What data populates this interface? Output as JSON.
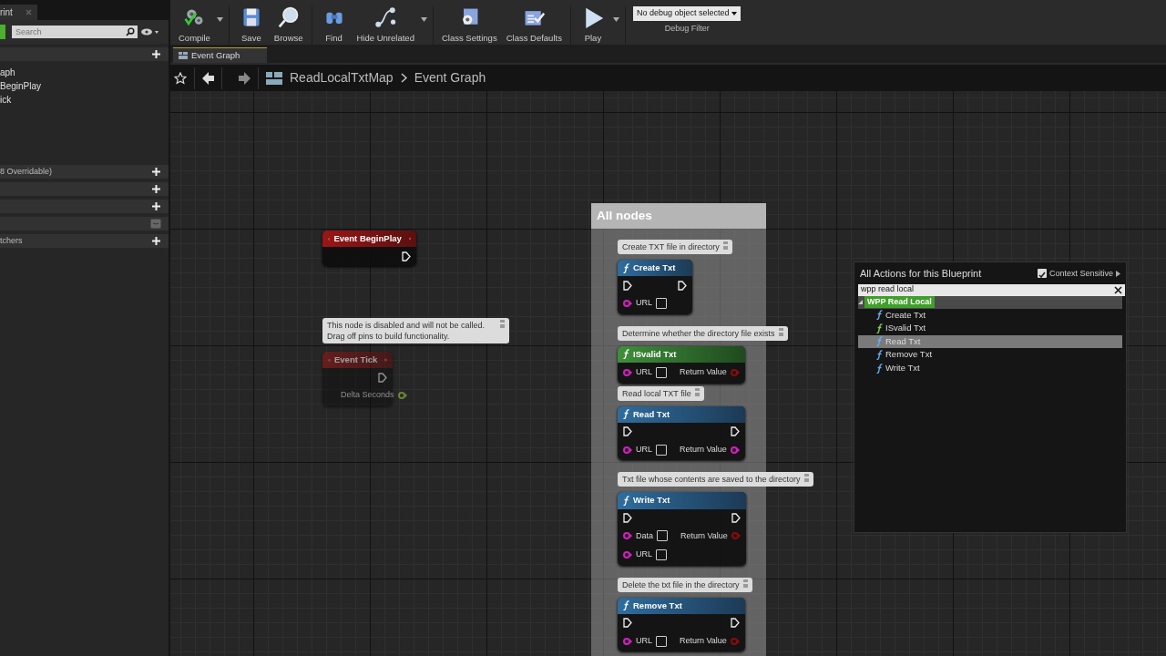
{
  "editor_tab": {
    "label": "rint"
  },
  "left_panel": {
    "search": {
      "placeholder": "Search"
    },
    "sections": [
      {
        "kind": "add",
        "items": [
          "aph",
          "BeginPlay",
          "ick"
        ]
      },
      {
        "kind": "add",
        "label": "8 Overridable)"
      },
      {
        "kind": "add"
      },
      {
        "kind": "add"
      },
      {
        "kind": "fold"
      },
      {
        "kind": "add",
        "label": "tchers"
      }
    ]
  },
  "toolbar": [
    [
      {
        "label": "Compile",
        "kind": "compile",
        "dropdown": true
      }
    ],
    [
      {
        "label": "Save",
        "kind": "save",
        "dropdown": false
      },
      {
        "label": "Browse",
        "kind": "browse",
        "dropdown": false
      }
    ],
    [
      {
        "label": "Find",
        "kind": "find",
        "dropdown": false
      },
      {
        "label": "Hide Unrelated",
        "kind": "hide",
        "dropdown": true
      }
    ],
    [
      {
        "label": "Class Settings",
        "kind": "settings",
        "dropdown": false
      },
      {
        "label": "Class Defaults",
        "kind": "defaults",
        "dropdown": false
      }
    ],
    [
      {
        "label": "Play",
        "kind": "play",
        "dropdown": true
      }
    ]
  ],
  "debug_filter": {
    "value": "No debug object selected",
    "label": "Debug Filter"
  },
  "graph_tab": {
    "label": "Event Graph"
  },
  "breadcrumb": [
    "ReadLocalTxtMap",
    "Event Graph"
  ],
  "nodes": [
    {
      "kind": "event",
      "title": "Event BeginPlay",
      "disabled": false,
      "rows": [
        {
          "right": {
            "kind": "exec"
          }
        }
      ]
    },
    {
      "kind": "event",
      "title": "Event Tick",
      "disabled": true,
      "comment": "This node is disabled and will not be called. Drag off pins to build functionality.",
      "rows": [
        {
          "right": {
            "kind": "exec"
          }
        },
        {
          "right": {
            "kind": "float",
            "label": "Delta Seconds"
          }
        }
      ]
    }
  ],
  "comment_box": {
    "title": "All nodes",
    "nodes": [
      {
        "kind": "function",
        "title": "Create Txt",
        "comment": "Create TXT file in directory",
        "rows": [
          {
            "left": {
              "kind": "exec"
            },
            "right": {
              "kind": "exec"
            }
          },
          {
            "left": {
              "kind": "string",
              "label": "URL"
            }
          }
        ]
      },
      {
        "kind": "pure_function",
        "title": "ISvalid Txt",
        "comment": "Determine whether the directory file exists",
        "rows": [
          {
            "left": {
              "kind": "string",
              "label": "URL"
            },
            "right": {
              "kind": "bool",
              "label": "Return Value"
            }
          }
        ]
      },
      {
        "kind": "function",
        "title": "Read Txt",
        "comment": "Read local TXT file",
        "rows": [
          {
            "left": {
              "kind": "exec"
            },
            "right": {
              "kind": "exec"
            }
          },
          {
            "left": {
              "kind": "string",
              "label": "URL"
            },
            "right": {
              "kind": "string",
              "label": "Return Value"
            }
          }
        ]
      },
      {
        "kind": "function",
        "title": "Write Txt",
        "comment": "Txt file whose contents are saved to the directory",
        "rows": [
          {
            "left": {
              "kind": "exec"
            },
            "right": {
              "kind": "exec"
            }
          },
          {
            "left": {
              "kind": "string",
              "label": "Data"
            },
            "right": {
              "kind": "bool",
              "label": "Return Value"
            }
          },
          {
            "left": {
              "kind": "string",
              "label": "URL"
            }
          }
        ]
      },
      {
        "kind": "function",
        "title": "Remove Txt",
        "comment": "Delete the txt file in the directory",
        "rows": [
          {
            "left": {
              "kind": "exec"
            },
            "right": {
              "kind": "exec"
            }
          },
          {
            "left": {
              "kind": "string",
              "label": "URL"
            },
            "right": {
              "kind": "bool",
              "label": "Return Value"
            }
          }
        ]
      }
    ]
  },
  "action_menu": {
    "title": "All Actions for this Blueprint",
    "context_sensitive": {
      "label": "Context Sensitive",
      "checked": true
    },
    "search": {
      "value": "wpp read local"
    },
    "category": {
      "label": "WPP Read Local",
      "expanded": true
    },
    "items": [
      {
        "label": "Create Txt",
        "kind": "function",
        "selected": false
      },
      {
        "label": "ISvalid Txt",
        "kind": "pure_function",
        "selected": false
      },
      {
        "label": "Read Txt",
        "kind": "function",
        "selected": true
      },
      {
        "label": "Remove Txt",
        "kind": "function",
        "selected": false
      },
      {
        "label": "Write Txt",
        "kind": "function",
        "selected": false
      }
    ]
  }
}
